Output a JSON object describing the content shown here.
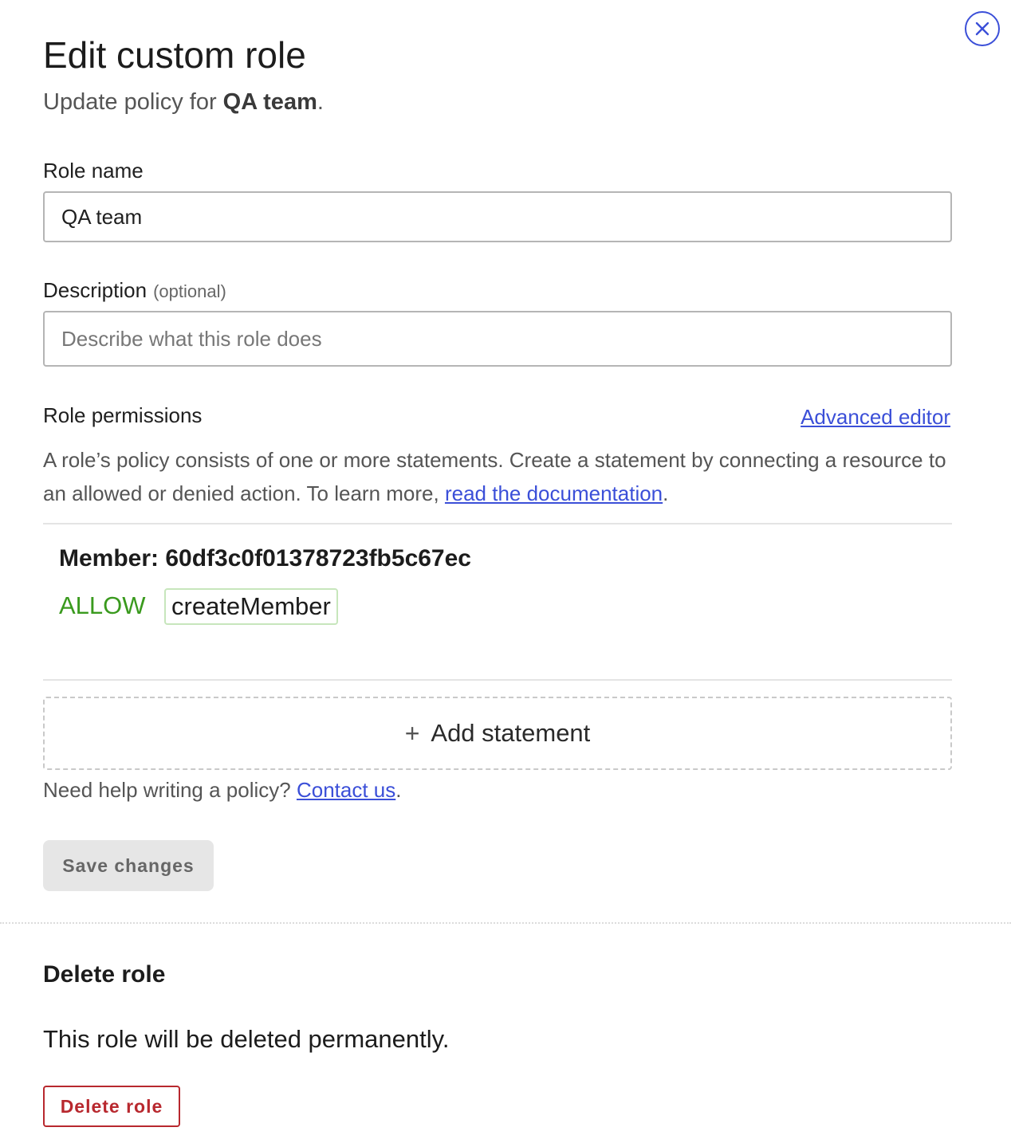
{
  "header": {
    "title": "Edit custom role",
    "subtitle_prefix": "Update policy for ",
    "subtitle_role": "QA team",
    "subtitle_suffix": "."
  },
  "close": {
    "icon": "close-circle-icon",
    "color": "#3b4fd8"
  },
  "role_name": {
    "label": "Role name",
    "value": "QA team"
  },
  "description": {
    "label": "Description",
    "optional": "(optional)",
    "value": "",
    "placeholder": "Describe what this role does"
  },
  "permissions": {
    "label": "Role permissions",
    "advanced_editor": "Advanced editor",
    "helper_text": "A role’s policy consists of one or more statements. Create a statement by connecting a resource to an allowed or denied action. To learn more, ",
    "doc_link": "read the documentation",
    "helper_suffix": "."
  },
  "statements": [
    {
      "resource": "Member: 60df3c0f01378723fb5c67ec",
      "effect": "ALLOW",
      "action": "createMember"
    }
  ],
  "add_statement": {
    "icon": "plus-icon",
    "icon_glyph": "+",
    "label": "Add statement"
  },
  "help": {
    "text": "Need help writing a policy? ",
    "link": "Contact us",
    "suffix": "."
  },
  "save_button": "Save changes",
  "delete_section": {
    "heading": "Delete role",
    "text": "This role will be deleted permanently.",
    "button": "Delete role"
  },
  "colors": {
    "accent": "#3b4fd8",
    "allow": "#3a9a1e",
    "danger": "#b8282e"
  }
}
